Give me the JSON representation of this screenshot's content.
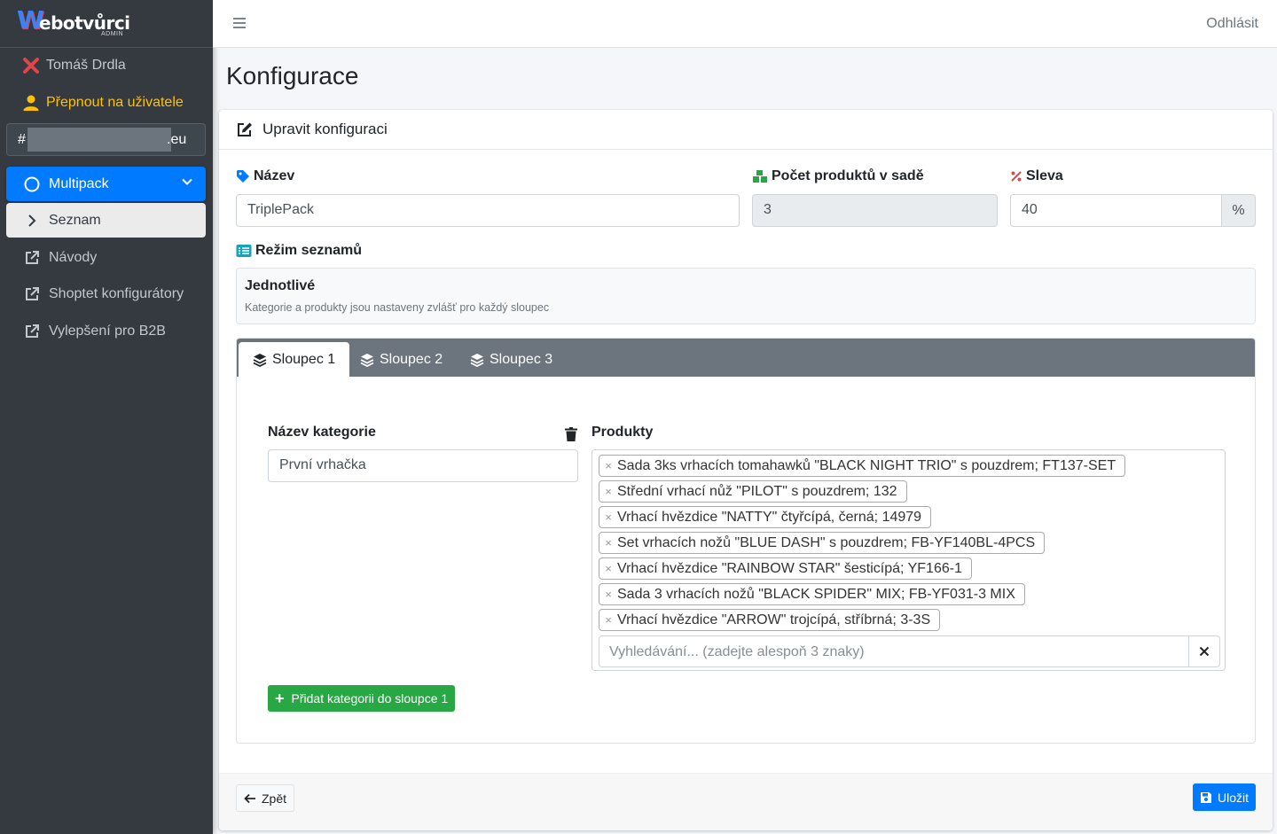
{
  "brand": {
    "w": "W",
    "rest": "ebotvůrci",
    "sub": "ADMIN"
  },
  "sidebar": {
    "user": "Tomáš Drdla",
    "switch_user": "Přepnout na uživatele",
    "shop_prefix": "#",
    "shop_suffix": ".eu",
    "items": [
      {
        "label": "Multipack",
        "icon": "circle-icon"
      },
      {
        "label": "Seznam",
        "icon": "chevron-right-icon"
      },
      {
        "label": "Návody",
        "icon": "external-link-icon"
      },
      {
        "label": "Shoptet konfigurátory",
        "icon": "external-link-icon"
      },
      {
        "label": "Vylepšení pro B2B",
        "icon": "external-link-icon"
      }
    ]
  },
  "header": {
    "logout": "Odhlásit"
  },
  "page": {
    "title": "Konfigurace"
  },
  "card": {
    "header": "Upravit konfiguraci",
    "fields": {
      "name_label": "Název",
      "name_value": "TriplePack",
      "count_label": "Počet produktů v sadě",
      "count_value": "3",
      "discount_label": "Sleva",
      "discount_value": "40",
      "discount_unit": "%"
    },
    "mode_label": "Režim seznamů",
    "mode": {
      "title": "Jednotlivé",
      "description": "Kategorie a produkty jsou nastaveny zvlášť pro každý sloupec"
    },
    "tabs": [
      "Sloupec 1",
      "Sloupec 2",
      "Sloupec 3"
    ],
    "column": {
      "category_label": "Název kategorie",
      "category_value": "První vrhačka",
      "products_label": "Produkty",
      "products": [
        "Sada 3ks vrhacích tomahawků \"BLACK NIGHT TRIO\" s pouzdrem; FT137-SET",
        "Střední vrhací nůž \"PILOT\" s pouzdrem; 132",
        "Vrhací hvězdice \"NATTY\" čtyřcípá, černá; 14979",
        "Set vrhacích nožů \"BLUE DASH\" s pouzdrem; FB-YF140BL-4PCS",
        "Vrhací hvězdice \"RAINBOW STAR\" šesticípá; YF166-1",
        "Sada 3 vrhacích nožů \"BLACK SPIDER\" MIX; FB-YF031-3 MIX",
        "Vrhací hvězdice \"ARROW\" trojcípá, stříbrná; 3-3S"
      ],
      "search_placeholder": "Vyhledávání... (zadejte alespoň 3 znaky)",
      "add_category": "Přidat kategorii do sloupce 1"
    },
    "footer": {
      "back": "Zpět",
      "save": "Uložit"
    }
  },
  "colors": {
    "primary": "#007bff",
    "success": "#28a745",
    "warning": "#ffc107",
    "danger": "#e0454a",
    "sidebar": "#343a40"
  }
}
